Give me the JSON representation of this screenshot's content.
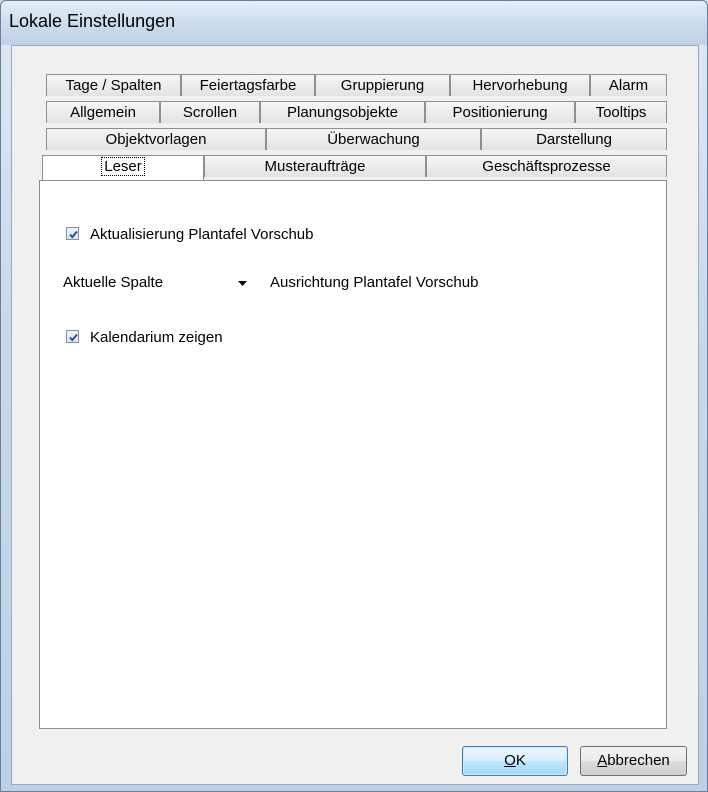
{
  "window": {
    "title": "Lokale Einstellungen"
  },
  "tabs": {
    "row1": [
      "Tage / Spalten",
      "Feiertagsfarbe",
      "Gruppierung",
      "Hervorhebung",
      "Alarm"
    ],
    "row2": [
      "Allgemein",
      "Scrollen",
      "Planungsobjekte",
      "Positionierung",
      "Tooltips"
    ],
    "row3": [
      "Objektvorlagen",
      "Überwachung",
      "Darstellung"
    ],
    "row4": [
      "Leser",
      "Musteraufträge",
      "Geschäftsprozesse"
    ],
    "active": "Leser"
  },
  "panel": {
    "refresh_checkbox": {
      "label": "Aktualisierung Plantafel Vorschub",
      "checked": true
    },
    "alignment": {
      "selected": "Aktuelle Spalte",
      "label": "Ausrichtung Plantafel Vorschub"
    },
    "calendar_checkbox": {
      "label": "Kalendarium zeigen",
      "checked": true
    }
  },
  "buttons": {
    "ok": {
      "mnemonic": "O",
      "rest": "K"
    },
    "cancel": {
      "mnemonic": "A",
      "rest": "bbrechen"
    }
  }
}
